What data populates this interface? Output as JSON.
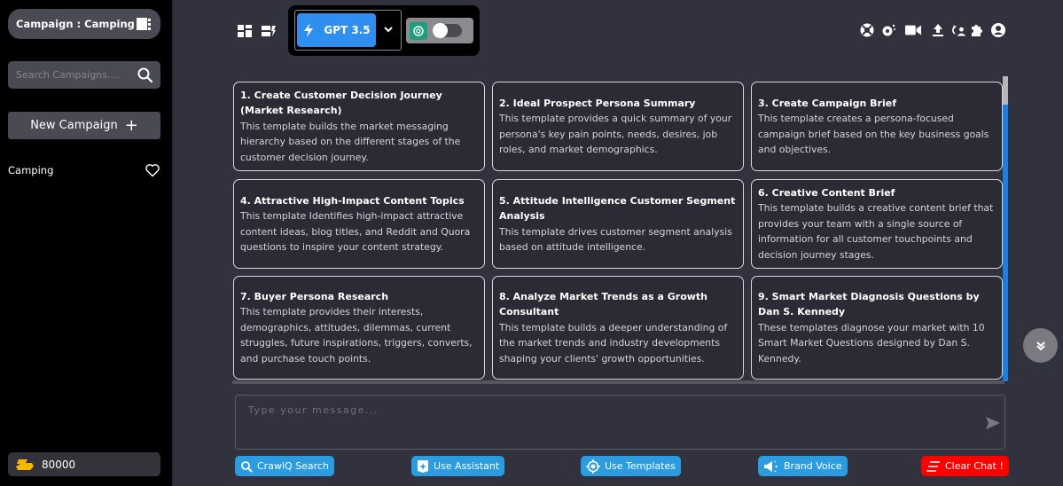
{
  "sidebar": {
    "campaign_header": "Campaign : Camping",
    "search_placeholder": "Search Campaigns....",
    "new_campaign_label": "New Campaign",
    "campaigns": [
      {
        "name": "Camping"
      }
    ],
    "credits": "80000"
  },
  "toolbar": {
    "model_label": "GPT 3.5",
    "toggle_state": "off",
    "icons": [
      "dashboard-icon",
      "layout-switch-icon",
      "help-lifebuoy-icon",
      "settings-icon",
      "video-icon",
      "upload-icon",
      "sync-user-icon",
      "plugin-icon",
      "account-icon"
    ]
  },
  "templates": [
    {
      "title": "1. Create Customer Decision Journey (Market Research)",
      "desc": "This template builds the market messaging hierarchy based on the different stages of the customer decision journey."
    },
    {
      "title": "2. Ideal Prospect Persona Summary",
      "desc": "This template provides a quick summary of your persona's key pain points, needs, desires, job roles, and market demographics."
    },
    {
      "title": "3. Create Campaign Brief",
      "desc": "This template creates a persona-focused campaign brief based on the key business goals and objectives."
    },
    {
      "title": "4. Attractive High-Impact Content Topics",
      "desc": "This template Identifies high-impact attractive content ideas, blog titles, and Reddit and Quora questions to inspire your content strategy."
    },
    {
      "title": "5. Attitude Intelligence Customer Segment Analysis",
      "desc": "This template drives customer segment analysis based on attitude intelligence."
    },
    {
      "title": "6. Creative Content Brief",
      "desc": "This template builds a creative content brief that provides your team with a single source of information for all customer touchpoints and decision journey stages."
    },
    {
      "title": "7. Buyer Persona Research",
      "desc": "This template provides their interests, demographics, attitudes, dilemmas, current struggles, future inspirations, triggers, converts, and purchase touch points."
    },
    {
      "title": "8. Analyze Market Trends as a Growth Consultant",
      "desc": "This template builds a deeper understanding of the market trends and industry developments shaping your clients' growth opportunities."
    },
    {
      "title": "9. Smart Market Diagnosis Questions by Dan S. Kennedy",
      "desc": "These templates diagnose your market with 10 Smart Market Questions designed by Dan S. Kennedy."
    }
  ],
  "composer": {
    "placeholder": "Type your message...",
    "value": ""
  },
  "actions": {
    "crawliq": "CrawlQ Search",
    "assistant": "Use Assistant",
    "templates": "Use Templates",
    "brand_voice": "Brand Voice",
    "clear_chat": "Clear Chat !"
  },
  "colors": {
    "accent_blue": "#2f8ff0",
    "action_blue": "#2b9ce0",
    "danger_red": "#ff0000",
    "credit_gold": "#f5b800"
  }
}
